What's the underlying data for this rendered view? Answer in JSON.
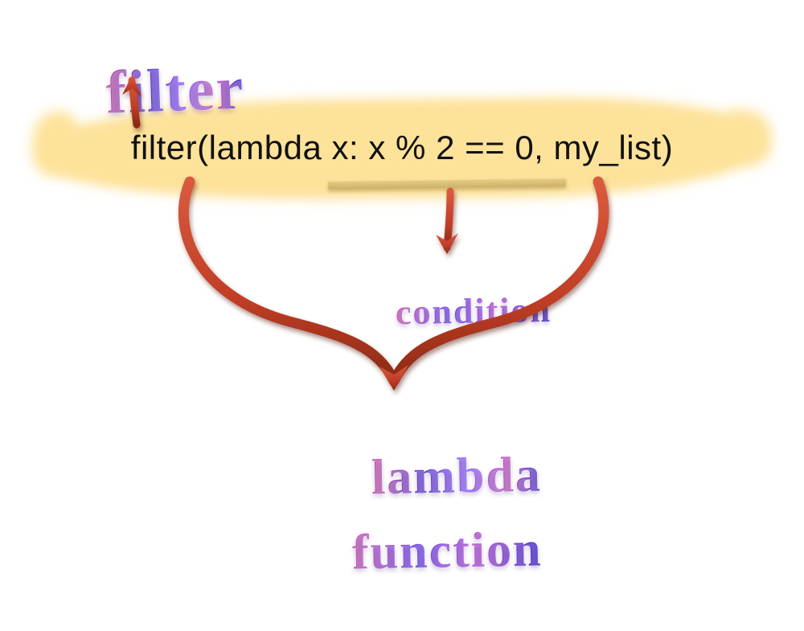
{
  "labels": {
    "filter": "filter",
    "condition": "condition",
    "lambda": "lambda",
    "function": "function"
  },
  "code": {
    "full": "filter(lambda x: x % 2 == 0, my_list)",
    "filter_call": "filter",
    "lambda_expr": "lambda x: x % 2 == 0",
    "condition_expr": "x % 2 == 0",
    "iterable": "my_list"
  },
  "annotations": [
    {
      "label": "filter",
      "points_to": "code.filter_call",
      "direction": "up"
    },
    {
      "label": "condition",
      "points_to": "code.condition_expr",
      "direction": "down"
    },
    {
      "label": "lambda function",
      "points_to": "code.lambda_expr",
      "direction": "down-brace"
    }
  ],
  "colors": {
    "highlight": "#fde29a",
    "arrow": "#c6432a",
    "arrow_shadow": "#7a2414",
    "gradient_pink": "#d85aa8",
    "gradient_purple": "#5b3bd6",
    "gradient_violet": "#8f62ff",
    "code_text": "#111111"
  }
}
